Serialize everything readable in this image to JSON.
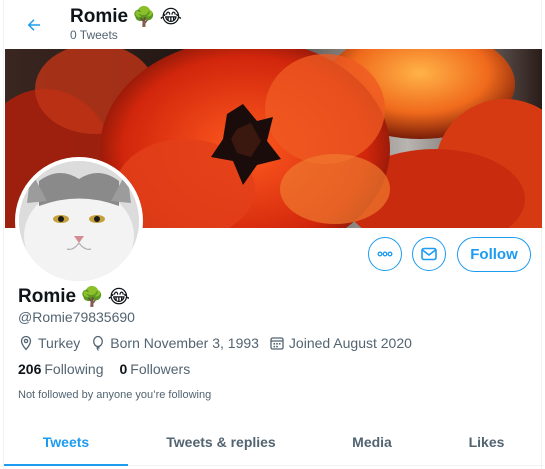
{
  "header": {
    "name": "Romie",
    "tweet_count": "0 Tweets"
  },
  "profile": {
    "name": "Romie",
    "emoji_tree": "🌳",
    "emoji_laugh": "😂",
    "handle": "@Romie79835690",
    "location": "Turkey",
    "born": "Born November 3, 1993",
    "joined": "Joined August 2020",
    "following_count": "206",
    "following_label": "Following",
    "followers_count": "0",
    "followers_label": "Followers",
    "not_followed_text": "Not followed by anyone you’re following"
  },
  "actions": {
    "follow_label": "Follow"
  },
  "tabs": [
    {
      "label": "Tweets",
      "active": true
    },
    {
      "label": "Tweets & replies",
      "active": false
    },
    {
      "label": "Media",
      "active": false
    },
    {
      "label": "Likes",
      "active": false
    }
  ],
  "colors": {
    "accent": "#1d9bf0",
    "secondary_text": "#536471"
  }
}
